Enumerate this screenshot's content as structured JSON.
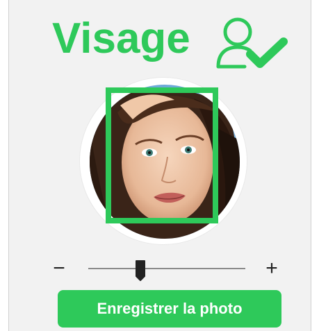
{
  "header": {
    "title": "Visage",
    "icon": "user-check-icon"
  },
  "zoom": {
    "minus_label": "−",
    "plus_label": "+",
    "level": 0.33
  },
  "actions": {
    "save_label": "Enregistrer la photo"
  },
  "colors": {
    "accent": "#2ec95a",
    "background": "#f2f2f2",
    "button_text": "#ffffff"
  }
}
